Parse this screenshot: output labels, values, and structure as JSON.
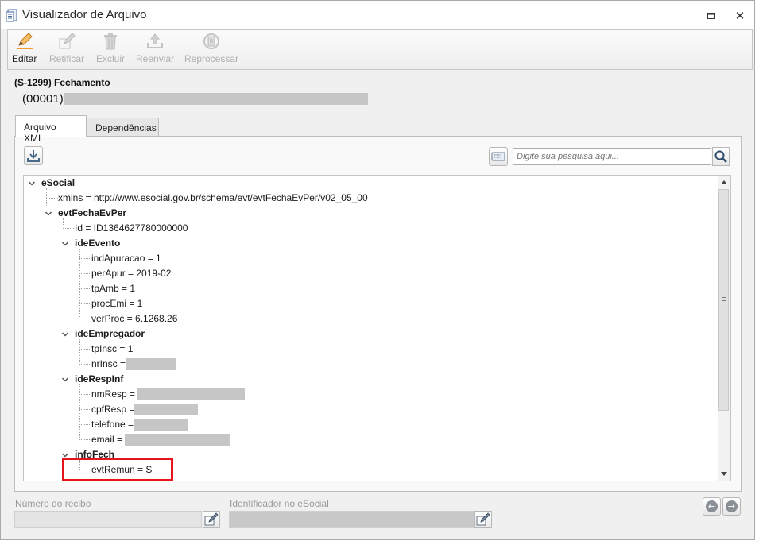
{
  "window": {
    "title": "Visualizador de Arquivo",
    "controls": [
      "restore-icon",
      "close-icon"
    ]
  },
  "toolbar": {
    "buttons": [
      {
        "label": "Editar",
        "icon": "pencil-icon",
        "enabled": true
      },
      {
        "label": "Retificar",
        "icon": "edit-pen-icon",
        "enabled": false
      },
      {
        "label": "Excluir",
        "icon": "trash-icon",
        "enabled": false
      },
      {
        "label": "Reenviar",
        "icon": "upload-icon",
        "enabled": false
      },
      {
        "label": "Reprocessar",
        "icon": "reprocess-icon",
        "enabled": false
      }
    ]
  },
  "event": {
    "title": "(S-1299) Fechamento",
    "subtitle": "(00001)"
  },
  "tabs": [
    {
      "label": "Arquivo XML",
      "active": true
    },
    {
      "label": "Dependências",
      "active": false
    }
  ],
  "search": {
    "placeholder": "Digite sua pesquisa aqui..."
  },
  "tree": {
    "nodes": [
      {
        "text": "eSocial",
        "type": "element",
        "expanded": true
      },
      {
        "text": "xmlns = http://www.esocial.gov.br/schema/evt/evtFechaEvPer/v02_05_00",
        "type": "attribute"
      },
      {
        "text": "evtFechaEvPer",
        "type": "element",
        "expanded": true
      },
      {
        "text": "Id = ID1364627780000000",
        "type": "attribute"
      },
      {
        "text": "ideEvento",
        "type": "element",
        "expanded": true
      },
      {
        "text": "indApuracao = 1",
        "type": "value"
      },
      {
        "text": "perApur = 2019-02",
        "type": "value"
      },
      {
        "text": "tpAmb = 1",
        "type": "value"
      },
      {
        "text": "procEmi = 1",
        "type": "value"
      },
      {
        "text": "verProc = 6.1268.26",
        "type": "value"
      },
      {
        "text": "ideEmpregador",
        "type": "element",
        "expanded": true
      },
      {
        "text": "tpInsc = 1",
        "type": "value"
      },
      {
        "text": "nrInsc =",
        "type": "value",
        "redacted": true
      },
      {
        "text": "ideRespInf",
        "type": "element",
        "expanded": true
      },
      {
        "text": "nmResp =",
        "type": "value",
        "redacted": true
      },
      {
        "text": "cpfResp =",
        "type": "value",
        "redacted": true
      },
      {
        "text": "telefone =",
        "type": "value",
        "redacted": true
      },
      {
        "text": "email =",
        "type": "value",
        "redacted": true
      },
      {
        "text": "infoFech",
        "type": "element",
        "expanded": true
      },
      {
        "text": "evtRemun = S",
        "type": "value",
        "highlighted": true
      }
    ]
  },
  "footer": {
    "receipt_label": "Número do recibo",
    "receipt_value": "",
    "esocial_id_label": "Identificador no eSocial",
    "esocial_id_value": ""
  },
  "colors": {
    "highlight_border": "#e8141c",
    "redaction": "#c6c6c6"
  }
}
